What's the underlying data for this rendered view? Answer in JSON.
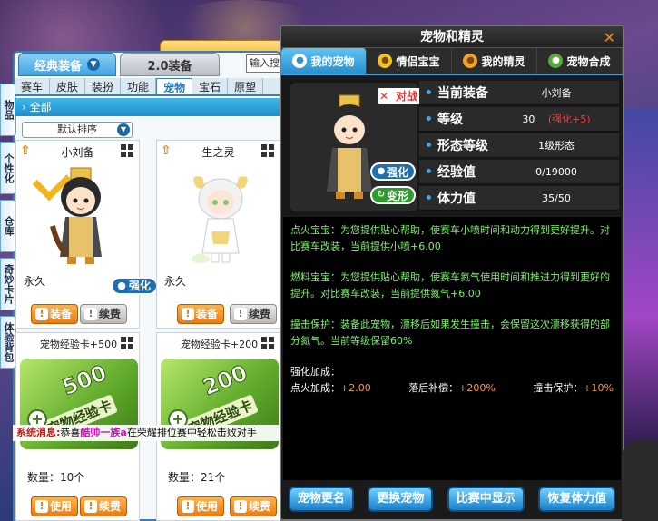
{
  "top_tabs": [
    {
      "label": "经典装备",
      "active": true
    },
    {
      "label": "2.0装备",
      "active": false
    }
  ],
  "search": {
    "placeholder": "输入搜"
  },
  "side_tabs": [
    "物品",
    "个性化",
    "仓库",
    "奇妙卡片",
    "体验背包"
  ],
  "sub_tabs": [
    "赛车",
    "皮肤",
    "装扮",
    "功能",
    "宠物",
    "宝石",
    "原望"
  ],
  "active_sub_tab": "宠物",
  "filter": {
    "label": "全部"
  },
  "sort": {
    "label": "默认排序"
  },
  "cards": [
    {
      "name": "小刘备",
      "duration": "永久",
      "badge": "强化",
      "btn_primary": "装备",
      "btn_secondary": "续费"
    },
    {
      "name": "生之灵",
      "duration": "永久",
      "btn_primary": "装备",
      "btn_secondary": "续费"
    },
    {
      "name": "宠物经验卡+500",
      "card_num": "500",
      "card_label": "宠物经验卡",
      "quantity": "数量：10个",
      "btn_primary": "使用",
      "btn_secondary": "续费"
    },
    {
      "name": "宠物经验卡+200",
      "card_num": "200",
      "card_label": "宠物经验卡",
      "quantity": "数量：21个",
      "btn_primary": "使用",
      "btn_secondary": "续费"
    }
  ],
  "ticker": {
    "system": "系统消息:",
    "prefix": "恭喜",
    "player": "酷帅一族a",
    "suffix": "在荣耀排位赛中轻松击败对手"
  },
  "dialog": {
    "title": "宠物和精灵",
    "tabs": [
      {
        "label": "我的宠物",
        "active": true,
        "icon": "paw-icon"
      },
      {
        "label": "情侣宝宝",
        "active": false,
        "icon": "baby-icon"
      },
      {
        "label": "我的精灵",
        "active": false,
        "icon": "spirit-icon"
      },
      {
        "label": "宠物合成",
        "active": false,
        "icon": "turtle-icon"
      }
    ],
    "tags": {
      "battle": "对战",
      "enhance": "强化",
      "transform": "变形"
    },
    "info": [
      {
        "label": "当前装备",
        "value": "小刘备"
      },
      {
        "label": "等级",
        "value": "30",
        "extra": "(强化+5)"
      },
      {
        "label": "形态等级",
        "value": "1级形态"
      },
      {
        "label": "经验值",
        "value": "0/19000"
      },
      {
        "label": "体力值",
        "value": "35/50"
      }
    ],
    "skills": [
      "点火宝宝：为您提供贴心帮助，使赛车小喷时间和动力得到更好提升。对比赛车改装，当前提供小喷+6.00",
      "燃料宝宝：为您提供贴心帮助，使赛车氮气使用时间和推进力得到更好的提升。对比赛车改装，当前提供氮气+6.00",
      "撞击保护：装备此宠物，漂移后如果发生撞击，会保留这次漂移获得的部分氮气。当前等级保留60%"
    ],
    "enhance_title": "强化加成：",
    "enhance_stats": [
      {
        "label": "点火加成：",
        "value": "+2.00"
      },
      {
        "label": "落后补偿：",
        "value": "+200%"
      },
      {
        "label": "撞击保护：",
        "value": "+10%"
      }
    ],
    "buttons": [
      "宠物更名",
      "更换宠物",
      "比赛中显示",
      "恢复体力值"
    ]
  },
  "colors": {
    "accent": "#3da4e0",
    "orange_btn": "#ee7a10",
    "green_text": "#7ef26b",
    "red_text": "#ff3838"
  }
}
